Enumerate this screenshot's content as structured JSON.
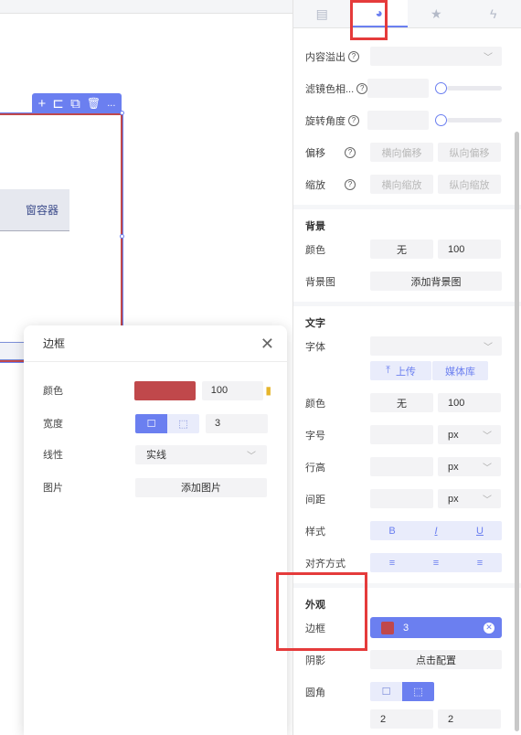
{
  "canvas": {
    "toolbar_icons": [
      "plus-icon",
      "import-icon",
      "copy-icon",
      "delete-icon",
      "more-icon"
    ],
    "toolbar_glyphs": [
      "+",
      "⊏",
      "⧉",
      "🗑",
      "..."
    ],
    "window_button_label": "窗容器"
  },
  "popup": {
    "title": "边框",
    "close_glyph": "✕",
    "color_label": "颜色",
    "color_value": "#c0484b",
    "opacity_value": "100",
    "width_label": "宽度",
    "width_value": "3",
    "style_label": "线性",
    "style_value": "实线",
    "image_label": "图片",
    "image_button": "添加图片"
  },
  "panel": {
    "tabs": [
      {
        "icon": "document-icon",
        "active": false
      },
      {
        "icon": "palette-icon",
        "active": true
      },
      {
        "icon": "star-icon",
        "active": false
      },
      {
        "icon": "lightning-icon",
        "active": false
      }
    ],
    "overflow_label": "内容溢出",
    "filter_label": "滤镜色相...",
    "rotate_label": "旋转角度",
    "offset_label": "偏移",
    "offset_x_placeholder": "横向偏移",
    "offset_y_placeholder": "纵向偏移",
    "scale_label": "缩放",
    "scale_x_placeholder": "横向缩放",
    "scale_y_placeholder": "纵向缩放",
    "background_title": "背景",
    "bg_color_label": "颜色",
    "bg_color_value": "无",
    "bg_opacity_value": "100",
    "bg_image_label": "背景图",
    "bg_image_button": "添加背景图",
    "text_title": "文字",
    "font_label": "字体",
    "upload_button": "上传",
    "media_button": "媒体库",
    "text_color_label": "颜色",
    "text_color_value": "无",
    "text_opacity_value": "100",
    "font_size_label": "字号",
    "line_height_label": "行高",
    "spacing_label": "间距",
    "unit_px": "px",
    "style_label": "样式",
    "style_bold": "B",
    "style_italic": "I",
    "style_underline": "U",
    "align_label": "对齐方式",
    "appearance_title": "外观",
    "border_label": "边框",
    "border_value": "3",
    "border_color": "#c0484b",
    "shadow_label": "阴影",
    "shadow_button": "点击配置",
    "radius_label": "圆角",
    "radius_value_1": "2",
    "radius_value_2": "2"
  }
}
